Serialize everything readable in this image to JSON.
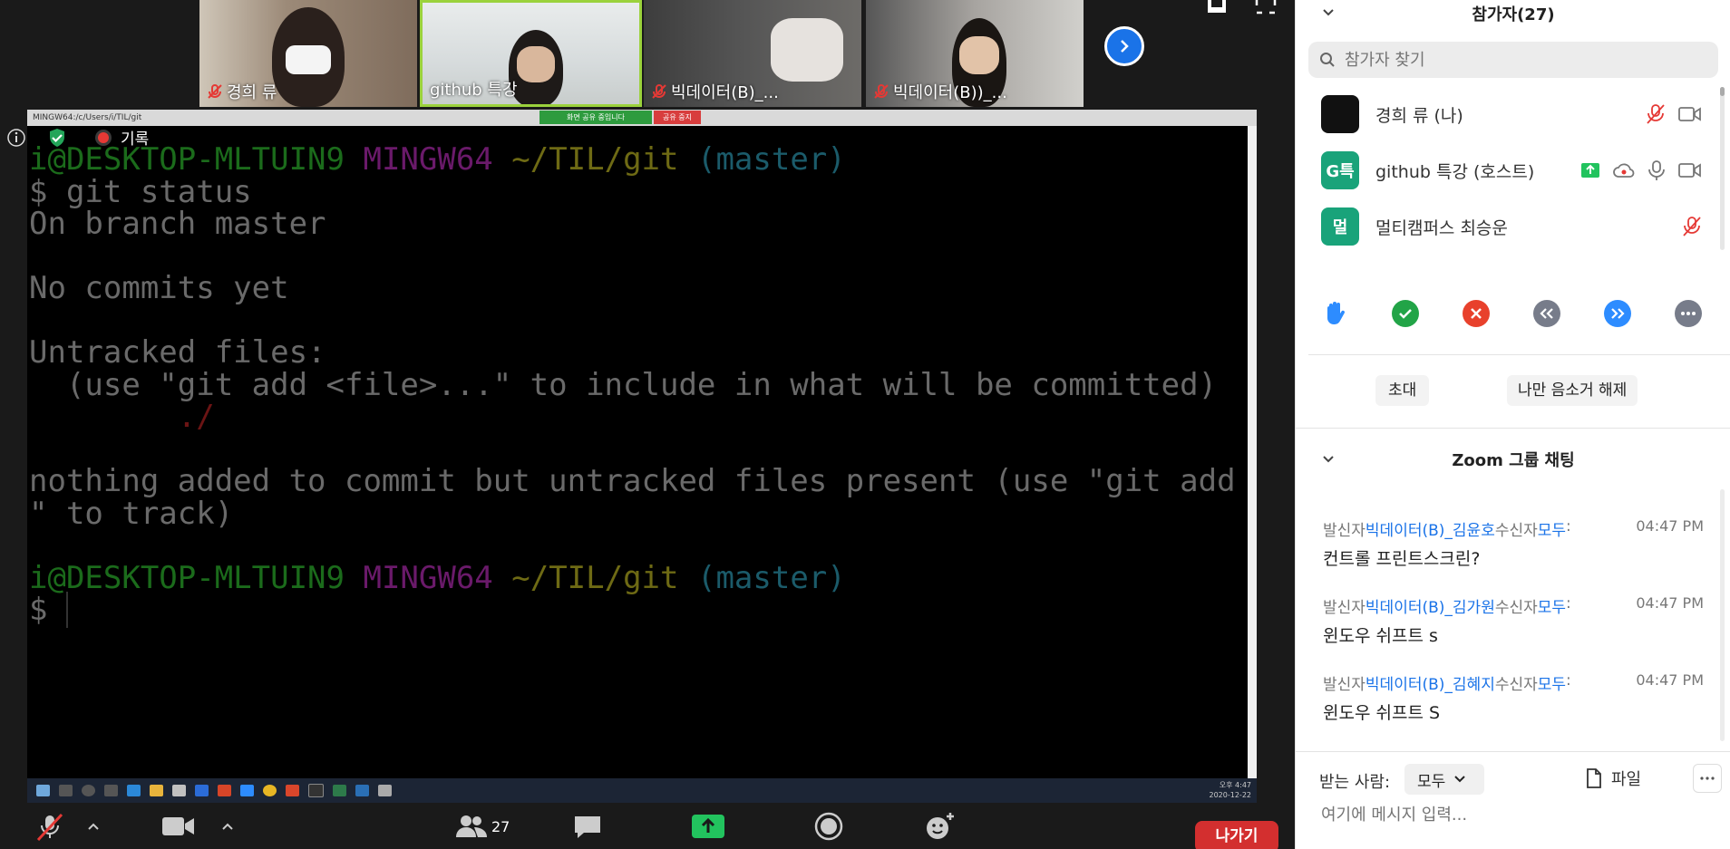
{
  "video_strip": {
    "tiles": [
      {
        "name": "경희 류",
        "muted": true
      },
      {
        "name": "github 특강",
        "muted": false,
        "active": true
      },
      {
        "name": "빅데이터(B)_...",
        "muted": true
      },
      {
        "name": "빅데이터(B))_...",
        "muted": true
      }
    ]
  },
  "status": {
    "recording_label": "기록"
  },
  "shared_screen": {
    "titlebar": "MINGW64:/c/Users/i/TIL/git",
    "banner_sharing": "화면 공유 중입니다",
    "banner_stop": "공유 중지",
    "terminal": {
      "prompt_user": "i@DESKTOP-MLTUIN9",
      "prompt_env": "MINGW64",
      "prompt_path": "~/TIL/git",
      "prompt_branch": "(master)",
      "cmd_line": "$ git status",
      "line_branch": "On branch master",
      "line_commits": "No commits yet",
      "line_untracked": "Untracked files:",
      "line_hint": "  (use \"git add <file>...\" to include in what will be committed)",
      "line_file": "        ./",
      "line_nothing1": "nothing added to commit but untracked files present (use \"git add",
      "line_nothing2": "\" to track)",
      "prompt_user2": "i@DESKTOP-MLTUIN9",
      "prompt_env2": "MINGW64",
      "prompt_path2": "~/TIL/git",
      "prompt_branch2": "(master)",
      "cursor_line": "$ "
    },
    "clock_time": "오후 4:47",
    "clock_date": "2020-12-22"
  },
  "toolbar": {
    "participants_count": "27",
    "leave_label": "나가기"
  },
  "participants_panel": {
    "title": "참가자(27)",
    "search_placeholder": "참가자 찾기",
    "participants": [
      {
        "name": "경희 류 (나)",
        "avatar_text": "",
        "avatar_color": "#111111"
      },
      {
        "name": "github 특강 (호스트)",
        "avatar_text": "G특",
        "avatar_color": "#19a37a"
      },
      {
        "name": "멀티캠퍼스 최승운",
        "avatar_text": "멀",
        "avatar_color": "#19a37a"
      }
    ],
    "invite_label": "초대",
    "unmute_me_label": "나만 음소거 해제"
  },
  "chat_panel": {
    "title": "Zoom 그룹 채팅",
    "messages": [
      {
        "from_prefix": "발신자",
        "from": "빅데이터(B)_김윤호",
        "to_prefix": "수신자",
        "to": "모두",
        "time": "04:47 PM",
        "text": "컨트롤 프린트스크린?"
      },
      {
        "from_prefix": "발신자",
        "from": "빅데이터(B)_김가원",
        "to_prefix": "수신자",
        "to": "모두",
        "time": "04:47 PM",
        "text": "윈도우 쉬프트 s"
      },
      {
        "from_prefix": "발신자",
        "from": "빅데이터(B)_김혜지",
        "to_prefix": "수신자",
        "to": "모두",
        "time": "04:47 PM",
        "text": "윈도우 쉬프트 S"
      }
    ],
    "to_label": "받는 사람:",
    "to_value": "모두",
    "file_label": "파일",
    "input_placeholder": "여기에 메시지 입력..."
  },
  "colors": {
    "accent": "#1a73e8",
    "leave": "#d32f2f",
    "share_green": "#22c35e",
    "host_avatar": "#19a37a"
  }
}
